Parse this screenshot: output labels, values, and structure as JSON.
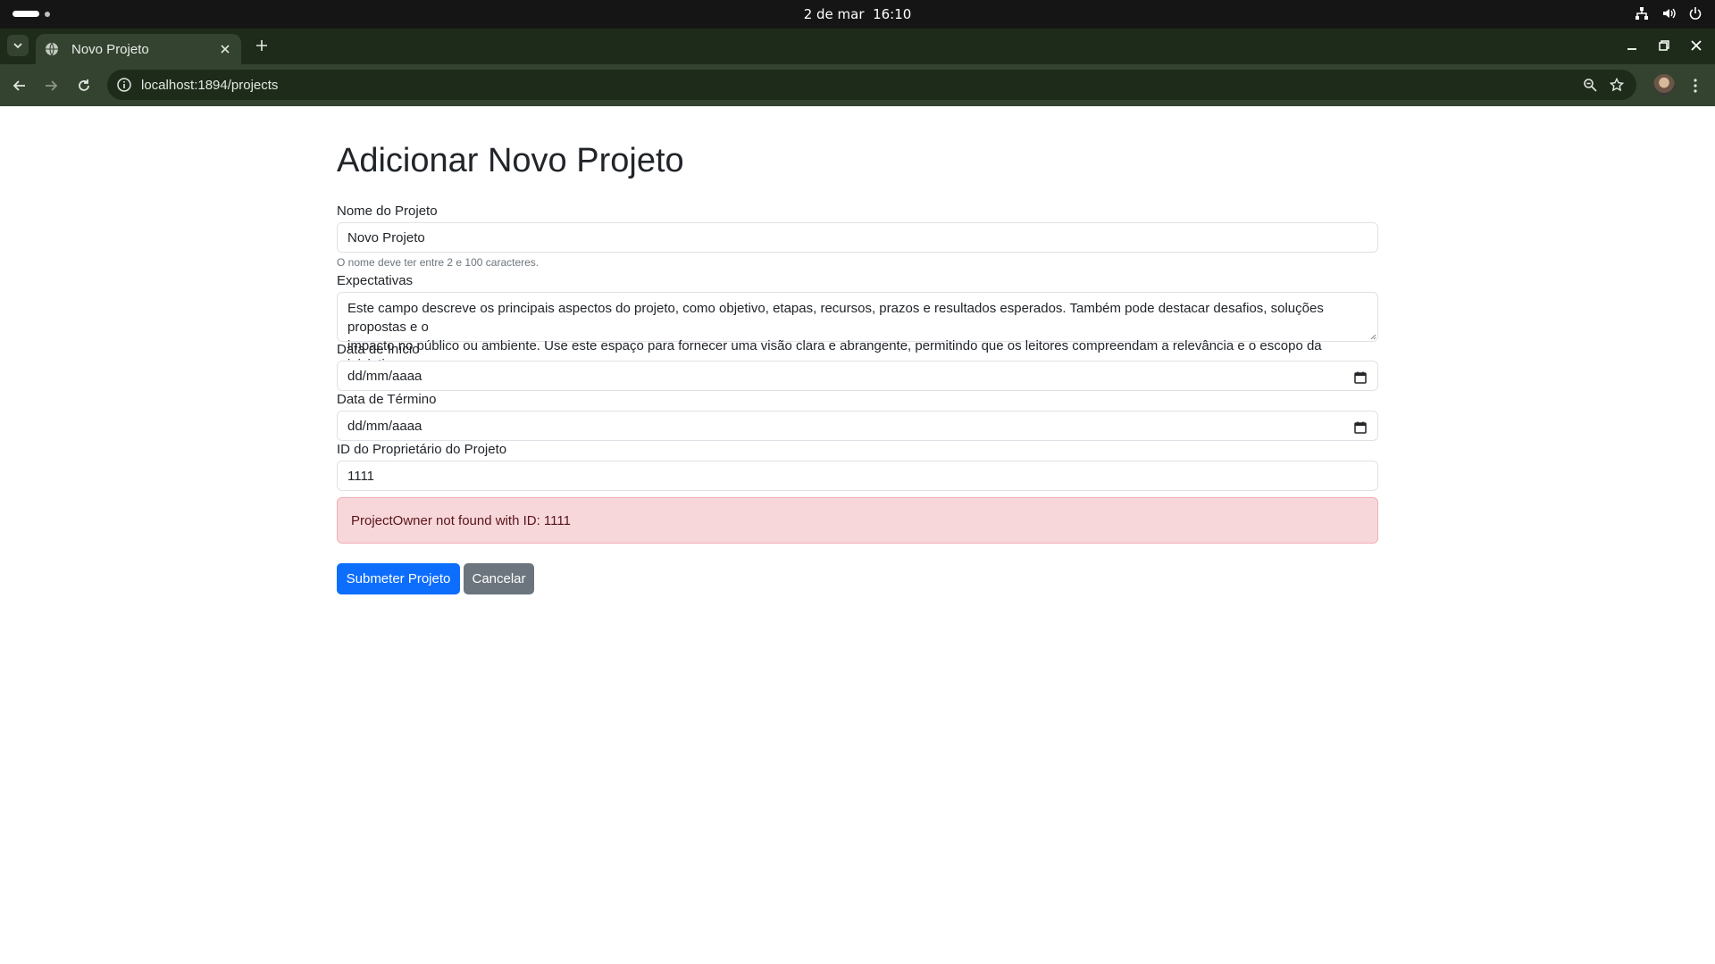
{
  "system": {
    "date": "2 de mar",
    "time": "16:10"
  },
  "browser": {
    "tab_title": "Novo Projeto",
    "url": "localhost:1894/projects"
  },
  "form": {
    "heading": "Adicionar Novo Projeto",
    "name_label": "Nome do Projeto",
    "name_value": "Novo Projeto",
    "name_help": "O nome deve ter entre 2 e 100 caracteres.",
    "expectations_label": "Expectativas",
    "expectations_line1": "Este campo descreve os principais aspectos do projeto, como objetivo, etapas, recursos, prazos e resultados esperados. Também pode destacar desafios, soluções propostas e o",
    "expectations_line2": "impacto no público ou ambiente. Use este espaço para fornecer uma visão clara e abrangente, permitindo que os leitores compreendam a relevância e o escopo da iniciativa.",
    "start_label": "Data de Início",
    "start_placeholder": "dd/mm/aaaa",
    "end_label": "Data de Término",
    "end_placeholder": "dd/mm/aaaa",
    "owner_label": "ID do Proprietário do Projeto",
    "owner_value": "1111",
    "error_message": "ProjectOwner not found with ID: 1111",
    "submit_label": "Submeter Projeto",
    "cancel_label": "Cancelar"
  },
  "colors": {
    "primary": "#0d6efd",
    "secondary": "#6c757d",
    "alert_bg": "#f8d7da",
    "alert_text": "#58151c",
    "browser_frame": "#34432f"
  }
}
